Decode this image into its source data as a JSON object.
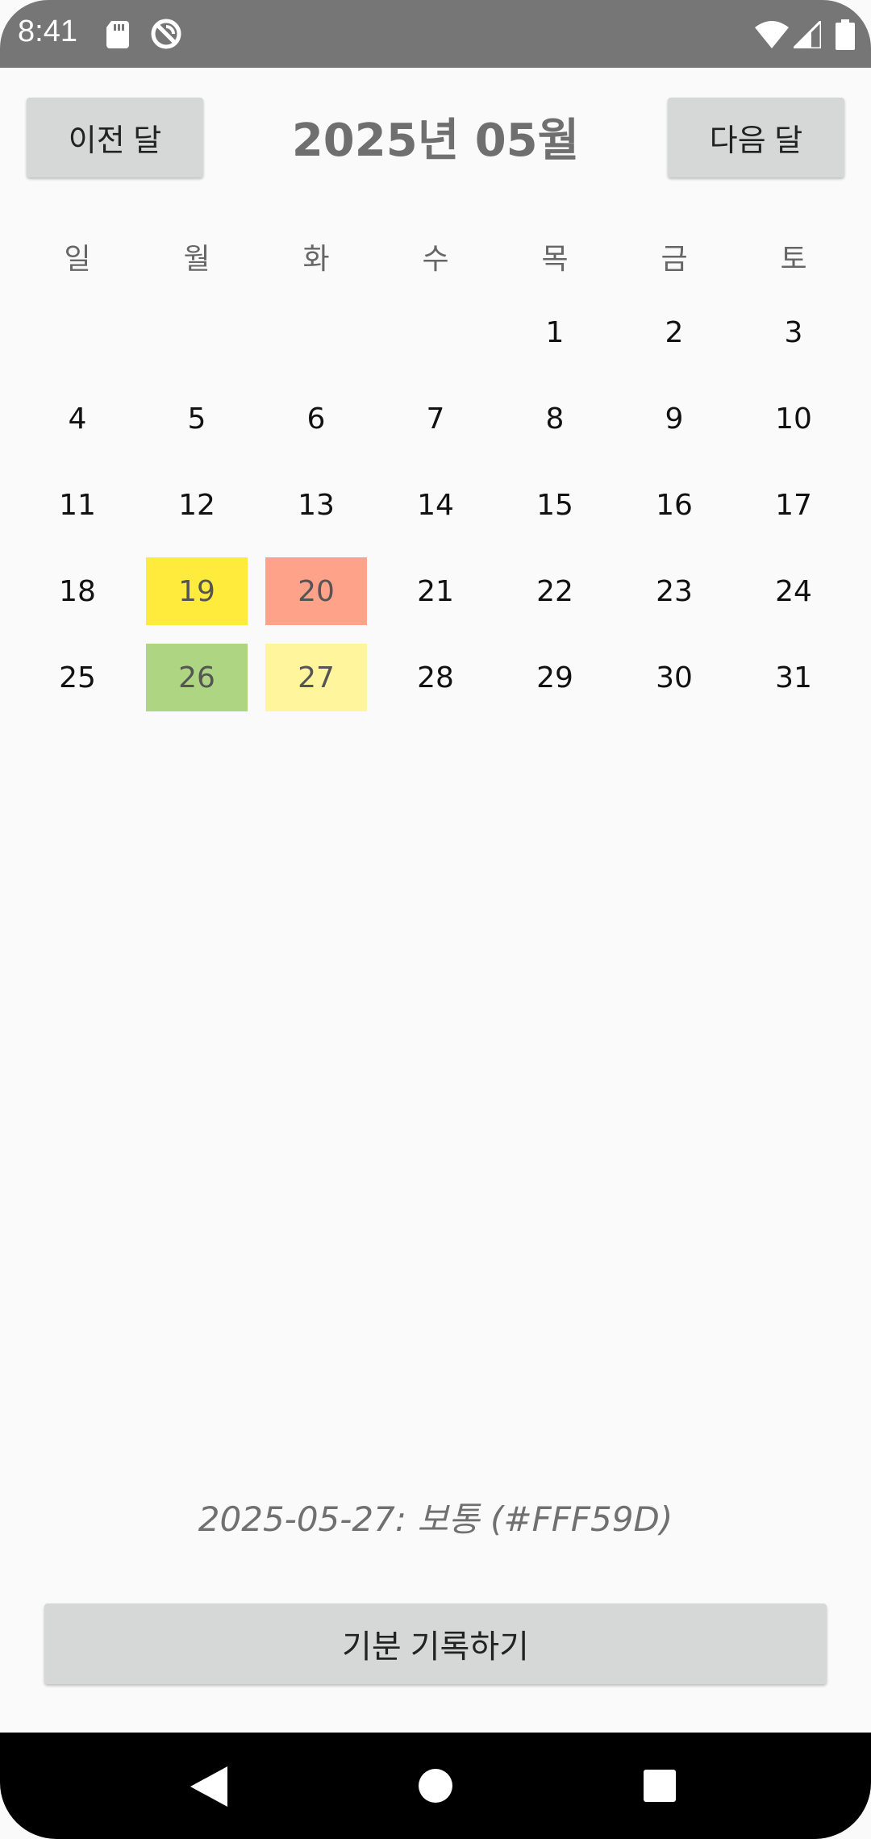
{
  "status_bar": {
    "time": "8:41",
    "icons": [
      "sd-card-icon",
      "do-not-disturb-icon",
      "wifi-icon",
      "cell-signal-icon",
      "battery-icon"
    ]
  },
  "header": {
    "prev_label": "이전 달",
    "title": "2025년 05월",
    "next_label": "다음 달"
  },
  "calendar": {
    "weekdays": [
      "일",
      "월",
      "화",
      "수",
      "목",
      "금",
      "토"
    ],
    "first_weekday_index": 4,
    "days": [
      "1",
      "2",
      "3",
      "4",
      "5",
      "6",
      "7",
      "8",
      "9",
      "10",
      "11",
      "12",
      "13",
      "14",
      "15",
      "16",
      "17",
      "18",
      "19",
      "20",
      "21",
      "22",
      "23",
      "24",
      "25",
      "26",
      "27",
      "28",
      "29",
      "30",
      "31"
    ],
    "mood_colors": {
      "19": "#FFEB3B",
      "20": "#FFA28A",
      "26": "#AED581",
      "27": "#FFF59D"
    }
  },
  "selected_info": "2025-05-27: 보통 (#FFF59D)",
  "record_button_label": "기분 기록하기",
  "nav_bar": {
    "icons": [
      "back-icon",
      "home-icon",
      "recents-icon"
    ]
  }
}
